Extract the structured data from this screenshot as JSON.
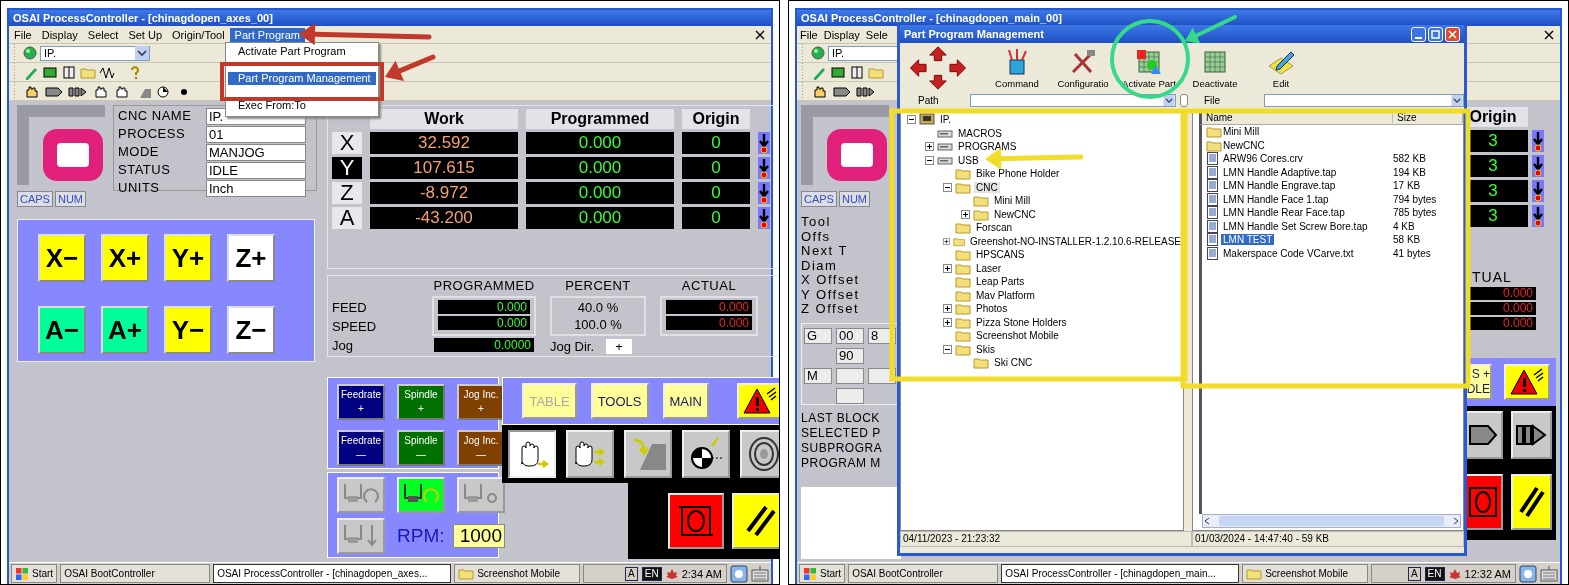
{
  "left_screen": {
    "window": {
      "title": "OSAI ProcessController - [chinagdopen_axes_00]"
    },
    "menu": [
      {
        "label": "File",
        "selected": false
      },
      {
        "label": "Display",
        "selected": false
      },
      {
        "label": "Select",
        "selected": false
      },
      {
        "label": "Set Up",
        "selected": false
      },
      {
        "label": "Origin/Tool",
        "selected": false
      },
      {
        "label": "Part Program",
        "selected": true
      }
    ],
    "dropdown_menu": [
      {
        "label": "Activate Part Program",
        "selected": false
      },
      {
        "label": "Part Program Management",
        "selected": true
      },
      {
        "label": "Exec From:To",
        "selected": false
      }
    ],
    "process_combo": {
      "value": "IP."
    },
    "keyboard_indicators": [
      "CAPS",
      "NUM"
    ],
    "info_fields": [
      {
        "label": "CNC NAME",
        "value": "IP."
      },
      {
        "label": "PROCESS",
        "value": "01"
      },
      {
        "label": "MODE",
        "value": "MANJOG"
      },
      {
        "label": "STATUS",
        "value": "IDLE"
      },
      {
        "label": "UNITS",
        "value": "Inch"
      }
    ],
    "axes": {
      "columns": [
        "Work",
        "Programmed",
        "Origin"
      ],
      "rows": [
        {
          "axis": "X",
          "work": "32.592",
          "programmed": "0.000",
          "origin": "0",
          "selected": false
        },
        {
          "axis": "Y",
          "work": "107.615",
          "programmed": "0.000",
          "origin": "0",
          "selected": true
        },
        {
          "axis": "Z",
          "work": "-8.972",
          "programmed": "0.000",
          "origin": "0",
          "selected": false
        },
        {
          "axis": "A",
          "work": "-43.200",
          "programmed": "0.000",
          "origin": "0",
          "selected": false
        }
      ]
    },
    "jog_buttons": [
      {
        "label": "X−",
        "color": "#ffff00"
      },
      {
        "label": "X+",
        "color": "#ffff00"
      },
      {
        "label": "Y+",
        "color": "#ffff00"
      },
      {
        "label": "Z+",
        "color": "#ffffff"
      },
      {
        "label": "A−",
        "color": "#00ff99"
      },
      {
        "label": "A+",
        "color": "#00ff99"
      },
      {
        "label": "Y−",
        "color": "#ffff00"
      },
      {
        "label": "Z−",
        "color": "#ffffff"
      }
    ],
    "feed_panel": {
      "columns": [
        "PROGRAMMED",
        "PERCENT",
        "ACTUAL"
      ],
      "rows": [
        {
          "label": "FEED",
          "programmed": "0.000",
          "percent": "40.0 %",
          "actual": "0.000"
        },
        {
          "label": "SPEED",
          "programmed": "0.000",
          "percent": "100.0 %",
          "actual": "0.000"
        }
      ],
      "jog": {
        "label": "Jog",
        "value": "0.0000"
      },
      "jog_dir": {
        "label": "Jog Dir.",
        "value": "+"
      }
    },
    "override_buttons": [
      {
        "label": "Feedrate",
        "sign": "+",
        "color": "#000080"
      },
      {
        "label": "Spindle",
        "sign": "+",
        "color": "#007000"
      },
      {
        "label": "Jog Inc.",
        "sign": "+",
        "color": "#804000"
      },
      {
        "label": "Feedrate",
        "sign": "—",
        "color": "#000080"
      },
      {
        "label": "Spindle",
        "sign": "—",
        "color": "#007000"
      },
      {
        "label": "Jog Inc.",
        "sign": "—",
        "color": "#804000"
      }
    ],
    "page_buttons": [
      {
        "label": "TABLE",
        "disabled": true
      },
      {
        "label": "TOOLS",
        "disabled": false
      },
      {
        "label": "MAIN",
        "disabled": false
      }
    ],
    "mode_buttons": [
      {
        "kind": "hand",
        "selected": true
      },
      {
        "kind": "hand-steps",
        "selected": false
      },
      {
        "kind": "ramp",
        "selected": false
      },
      {
        "kind": "target",
        "selected": false
      },
      {
        "kind": "rings",
        "selected": false
      }
    ],
    "spindle_buttons": [
      {
        "kind": "rotate-left",
        "selected": false
      },
      {
        "kind": "rotate-right",
        "selected": true
      },
      {
        "kind": "stop",
        "selected": false
      },
      {
        "kind": "down",
        "selected": false
      }
    ],
    "rpm": {
      "label": "RPM:",
      "value": "1000"
    },
    "taskbar": {
      "start": "Start",
      "tasks": [
        {
          "label": "OSAI BootController",
          "selected": false
        },
        {
          "label": "OSAI ProcessController - [chinagdopen_axes...",
          "selected": true
        },
        {
          "label": "Screenshot Mobile",
          "selected": false
        }
      ],
      "tray": [
        "A",
        "EN"
      ],
      "clock": "2:34 AM"
    }
  },
  "right_screen": {
    "window": {
      "title": "OSAI ProcessController - [chinagdopen_main_00]"
    },
    "menu": [
      {
        "label": "File",
        "selected": false
      },
      {
        "label": "Display",
        "selected": false
      },
      {
        "label": "Sele",
        "selected": false
      }
    ],
    "process_combo": {
      "value": "IP."
    },
    "keyboard_indicators": [
      "CAPS",
      "NUM"
    ],
    "tool_labels": [
      "Tool",
      "Offs",
      "Next T",
      "Diam",
      "X Offset",
      "Y Offset",
      "Z Offset"
    ],
    "g_codes": {
      "label": "G",
      "values": [
        "00",
        "8",
        "90"
      ]
    },
    "m_codes": {
      "label": "M"
    },
    "program_labels": [
      "LAST BLOCK",
      "SELECTED P",
      "SUBPROGRA",
      "PROGRAM M"
    ],
    "origin": {
      "header": "Origin",
      "values": [
        "3",
        "3",
        "3",
        "3"
      ]
    },
    "actual": {
      "header": "TUAL",
      "values": [
        "0.000",
        "0.000",
        "0.000"
      ]
    },
    "cut_button": {
      "lines": [
        "S +",
        "DLE"
      ]
    },
    "dialog": {
      "title": "Part Program Management",
      "tools": [
        {
          "kind": "command",
          "label": "Command"
        },
        {
          "kind": "configuration",
          "label": "Configuratio"
        },
        {
          "kind": "activate",
          "label": "Activate Part"
        },
        {
          "kind": "deactivate",
          "label": "Deactivate"
        },
        {
          "kind": "edit",
          "label": "Edit"
        }
      ],
      "path": {
        "label": "Path"
      },
      "file": {
        "label": "File"
      },
      "tree": [
        {
          "label": "IP.",
          "kind": "computer",
          "expanded": true,
          "selected": false,
          "children": [
            {
              "label": "MACROS",
              "kind": "drive",
              "selected": false
            },
            {
              "label": "PROGRAMS",
              "kind": "drive",
              "expanded": false,
              "selected": false
            },
            {
              "label": "USB",
              "kind": "drive",
              "expanded": true,
              "selected": false,
              "children": [
                {
                  "label": "Bike Phone Holder",
                  "kind": "folder",
                  "selected": false
                },
                {
                  "label": "CNC",
                  "kind": "folder",
                  "expanded": true,
                  "selected": true,
                  "children": [
                    {
                      "label": "Mini Mill",
                      "kind": "folder",
                      "selected": false
                    },
                    {
                      "label": "NewCNC",
                      "kind": "folder",
                      "expanded": false,
                      "selected": false
                    }
                  ]
                },
                {
                  "label": "Forscan",
                  "kind": "folder",
                  "selected": false
                },
                {
                  "label": "Greenshot-NO-INSTALLER-1.2.10.6-RELEASE",
                  "kind": "folder",
                  "expanded": false,
                  "selected": false
                },
                {
                  "label": "HPSCANS",
                  "kind": "folder",
                  "selected": false
                },
                {
                  "label": "Laser",
                  "kind": "folder",
                  "expanded": false,
                  "selected": false
                },
                {
                  "label": "Leap Parts",
                  "kind": "folder",
                  "selected": false
                },
                {
                  "label": "Mav Platform",
                  "kind": "folder",
                  "selected": false
                },
                {
                  "label": "Photos",
                  "kind": "folder",
                  "expanded": false,
                  "selected": false
                },
                {
                  "label": "Pizza Stone Holders",
                  "kind": "folder",
                  "expanded": false,
                  "selected": false
                },
                {
                  "label": "Screenshot Mobile",
                  "kind": "folder",
                  "selected": false
                },
                {
                  "label": "Skis",
                  "kind": "folder",
                  "expanded": true,
                  "selected": false,
                  "children": [
                    {
                      "label": "Ski CNC",
                      "kind": "folder",
                      "selected": false
                    }
                  ]
                }
              ]
            }
          ]
        }
      ],
      "files": {
        "columns": [
          "Name",
          "Size"
        ],
        "rows": [
          {
            "kind": "folder",
            "name": "Mini Mill",
            "selected": false
          },
          {
            "kind": "folder",
            "name": "NewCNC",
            "selected": false
          },
          {
            "kind": "file",
            "name": "ARW96 Cores.crv",
            "size": "582 KB",
            "selected": false
          },
          {
            "kind": "file",
            "name": "LMN Handle Adaptive.tap",
            "size": "194 KB",
            "selected": false
          },
          {
            "kind": "file",
            "name": "LMN Handle Engrave.tap",
            "size": "17 KB",
            "selected": false
          },
          {
            "kind": "file",
            "name": "LMN Handle Face 1.tap",
            "size": "794 bytes",
            "selected": false
          },
          {
            "kind": "file",
            "name": "LMN Handle Rear Face.tap",
            "size": "785 bytes",
            "selected": false
          },
          {
            "kind": "file",
            "name": "LMN Handle Set Screw Bore.tap",
            "size": "4 KB",
            "selected": false
          },
          {
            "kind": "file",
            "name": "LMN TEST",
            "size": "58 KB",
            "selected": true
          },
          {
            "kind": "file",
            "name": "Makerspace Code VCarve.txt",
            "size": "41 bytes",
            "selected": false
          }
        ]
      },
      "status": [
        "04/11/2023 - 21:23:32",
        "01/03/2024 - 14:47:40 - 59 KB"
      ]
    },
    "taskbar": {
      "start": "Start",
      "tasks": [
        {
          "label": "OSAI BootController",
          "selected": false
        },
        {
          "label": "OSAI ProcessController - [chinagdopen_main...",
          "selected": true
        },
        {
          "label": "Screenshot Mobile",
          "selected": false
        }
      ],
      "tray": [
        "A",
        "EN"
      ],
      "clock": "12:32 AM"
    }
  }
}
